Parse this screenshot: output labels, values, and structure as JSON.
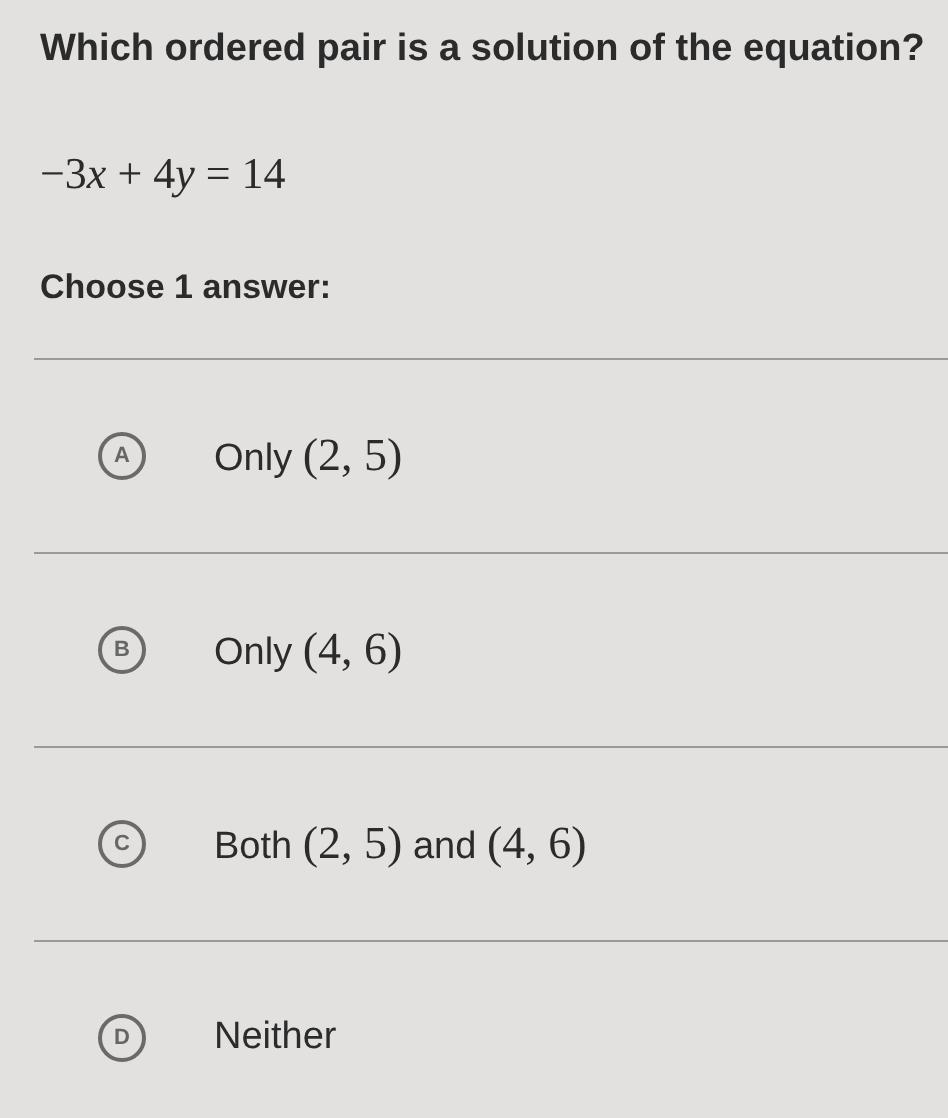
{
  "question": "Which ordered pair is a solution of the equation?",
  "equation": [
    {
      "kind": "num",
      "text": "−3"
    },
    {
      "kind": "var",
      "text": "x"
    },
    {
      "kind": "num",
      "text": " + 4"
    },
    {
      "kind": "var",
      "text": "y"
    },
    {
      "kind": "num",
      "text": " = 14"
    }
  ],
  "prompt": "Choose 1 answer:",
  "choices": [
    {
      "letter": "A",
      "parts": [
        {
          "kind": "text",
          "text": "Only "
        },
        {
          "kind": "math",
          "text": "(2, 5)"
        }
      ]
    },
    {
      "letter": "B",
      "parts": [
        {
          "kind": "text",
          "text": "Only "
        },
        {
          "kind": "math",
          "text": "(4, 6)"
        }
      ]
    },
    {
      "letter": "C",
      "parts": [
        {
          "kind": "text",
          "text": "Both "
        },
        {
          "kind": "math",
          "text": "(2, 5)"
        },
        {
          "kind": "text",
          "text": " and "
        },
        {
          "kind": "math",
          "text": "(4, 6)"
        }
      ]
    },
    {
      "letter": "D",
      "parts": [
        {
          "kind": "text",
          "text": "Neither"
        }
      ]
    }
  ]
}
